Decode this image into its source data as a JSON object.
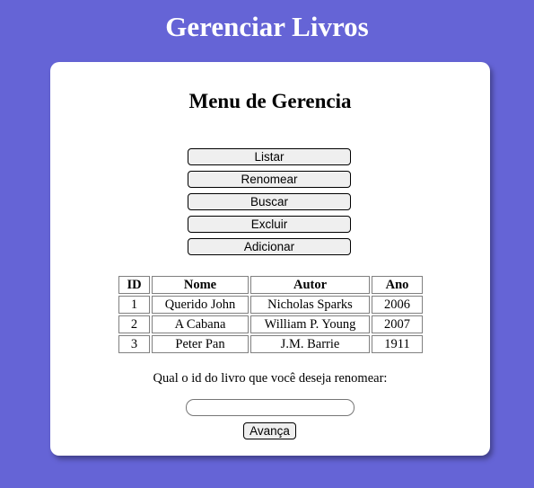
{
  "header": {
    "title": "Gerenciar Livros"
  },
  "card": {
    "title": "Menu de Gerencia"
  },
  "menu": {
    "items": [
      {
        "label": "Listar"
      },
      {
        "label": "Renomear"
      },
      {
        "label": "Buscar"
      },
      {
        "label": "Excluir"
      },
      {
        "label": "Adicionar"
      }
    ]
  },
  "table": {
    "headers": [
      "ID",
      "Nome",
      "Autor",
      "Ano"
    ],
    "rows": [
      [
        "1",
        "Querido John",
        "Nicholas Sparks",
        "2006"
      ],
      [
        "2",
        "A Cabana",
        "William P. Young",
        "2007"
      ],
      [
        "3",
        "Peter Pan",
        "J.M. Barrie",
        "1911"
      ]
    ]
  },
  "rename": {
    "question": "Qual o id do livro que você deseja renomear:",
    "input_value": "",
    "submit_label": "Avança"
  },
  "colors": {
    "background": "#6564d6",
    "card": "#ffffff"
  }
}
